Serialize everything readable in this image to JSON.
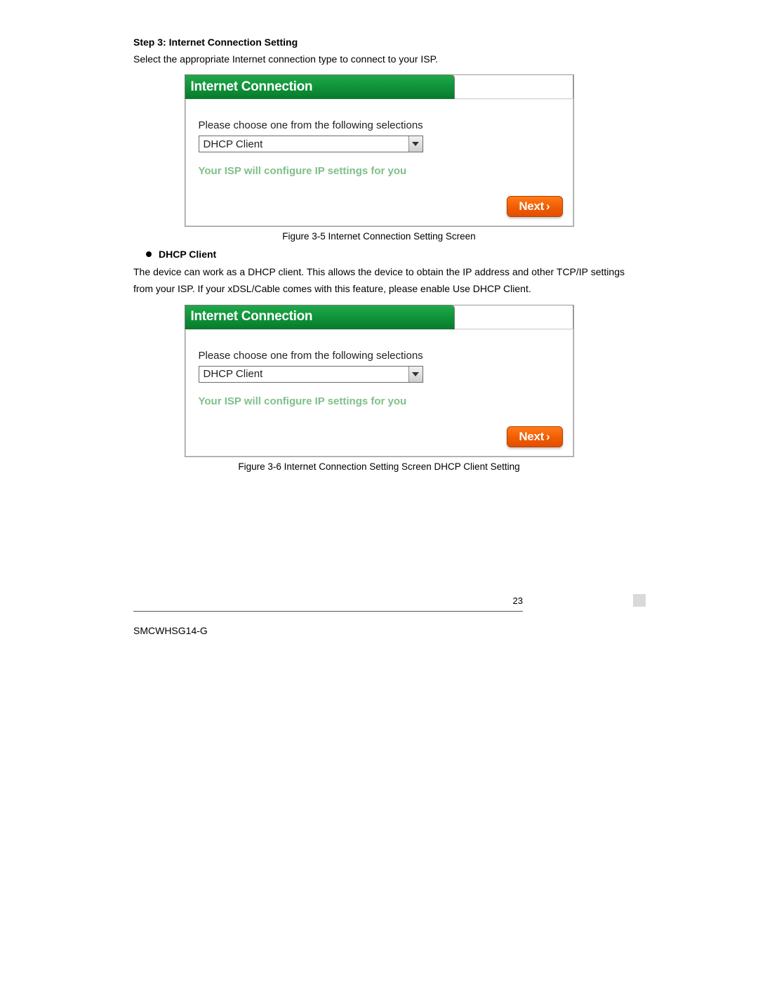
{
  "step": {
    "heading": "Step 3: Internet Connection Setting",
    "description": "Select the appropriate Internet connection type to connect to your ISP."
  },
  "figure1": {
    "header": "Internet Connection",
    "prompt": "Please choose one from the following selections",
    "selected": "DHCP Client",
    "hint": "Your ISP will configure IP settings for you",
    "next": "Next",
    "caption": "Figure 3-5 Internet Connection Setting Screen"
  },
  "dhcp": {
    "bullet": "DHCP Client",
    "para": "The device can work as a DHCP client. This allows the device to obtain the IP address and other TCP/IP settings from your ISP. If your xDSL/Cable comes with this feature, please enable Use DHCP Client."
  },
  "figure2": {
    "header": "Internet Connection",
    "prompt": "Please choose one from the following selections",
    "selected": "DHCP Client",
    "hint": "Your ISP will configure IP settings for you",
    "next": "Next",
    "caption": "Figure 3-6 Internet Connection Setting Screen DHCP Client Setting"
  },
  "footer": {
    "page": "23",
    "model": "SMCWHSG14-G"
  }
}
